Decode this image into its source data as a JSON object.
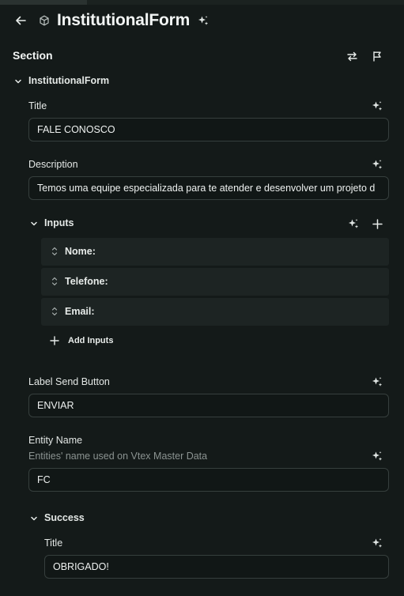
{
  "header": {
    "title": "InstitutionalForm",
    "icons": [
      "back-arrow-icon",
      "cube-icon",
      "sparkle-icon"
    ]
  },
  "section": {
    "title": "Section",
    "icons": [
      "swap-icon",
      "flag-icon"
    ]
  },
  "tree": {
    "root_label": "InstitutionalForm"
  },
  "fields": {
    "title": {
      "label": "Title",
      "value": "FALE CONOSCO"
    },
    "description": {
      "label": "Description",
      "value": "Temos uma equipe especializada para te atender e desenvolver um projeto d"
    },
    "label_send_button": {
      "label": "Label Send Button",
      "value": "ENVIAR"
    },
    "entity_name": {
      "label": "Entity Name",
      "help": "Entities' name used on Vtex Master Data",
      "value": "FC"
    }
  },
  "inputs": {
    "label": "Inputs",
    "items": [
      {
        "label": "Nome:"
      },
      {
        "label": "Telefone:"
      },
      {
        "label": "Email:"
      }
    ],
    "add_label": "Add Inputs"
  },
  "success": {
    "label": "Success",
    "title": {
      "label": "Title",
      "value": "OBRIGADO!"
    }
  },
  "colors": {
    "background": "#141a19",
    "field_border": "#363f3d",
    "row_background": "#1d2423",
    "text": "#e8ecea",
    "muted_text": "#8b9391"
  }
}
